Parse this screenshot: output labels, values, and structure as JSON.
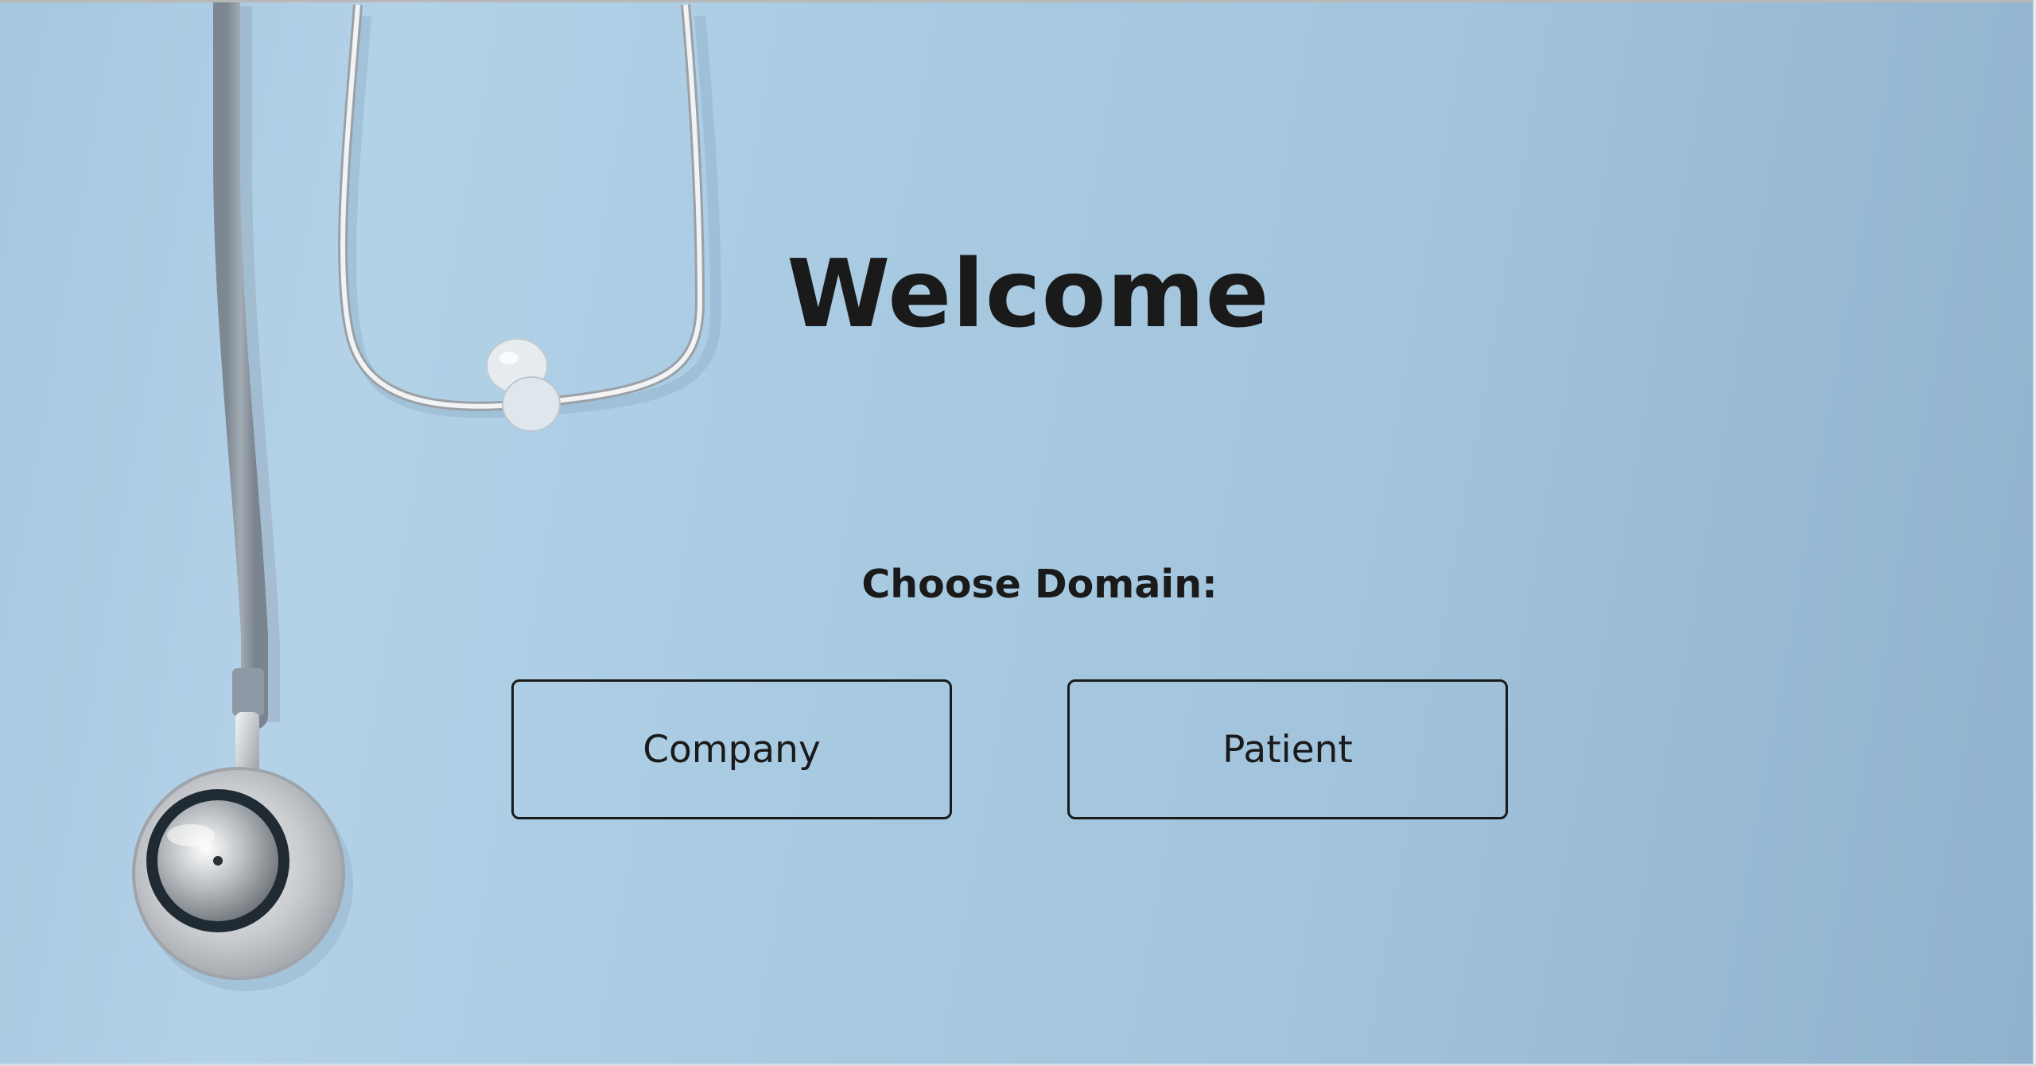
{
  "page": {
    "title": "Welcome",
    "prompt": "Choose Domain:"
  },
  "domains": [
    {
      "label": "Company"
    },
    {
      "label": "Patient"
    }
  ],
  "background": {
    "image": "stethoscope-image",
    "color": "#a9cbe2"
  },
  "colors": {
    "text": "#1a1a1a",
    "button_border": "#1a1a1a"
  }
}
